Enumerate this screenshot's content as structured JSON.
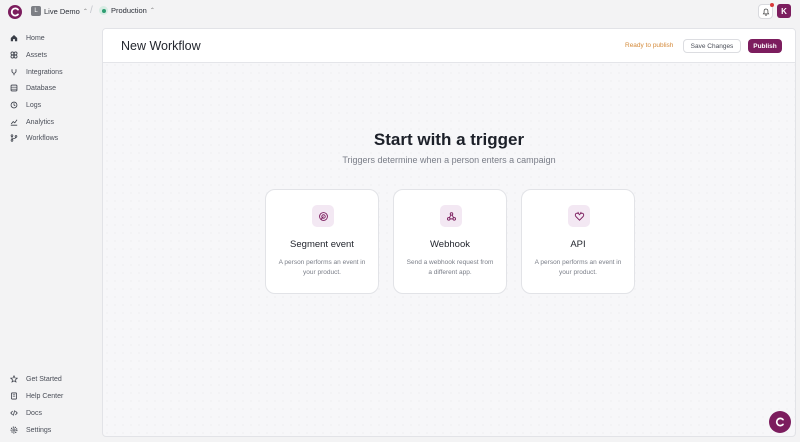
{
  "topbar": {
    "workspace_initial": "L",
    "workspace_name": "Live Demo",
    "separator": "/",
    "environment": "Production",
    "user_initial": "K"
  },
  "sidebar": {
    "primary": [
      {
        "label": "Home",
        "icon": "home-icon"
      },
      {
        "label": "Assets",
        "icon": "assets-icon"
      },
      {
        "label": "Integrations",
        "icon": "integrations-icon"
      },
      {
        "label": "Database",
        "icon": "database-icon"
      },
      {
        "label": "Logs",
        "icon": "logs-icon"
      },
      {
        "label": "Analytics",
        "icon": "analytics-icon"
      },
      {
        "label": "Workflows",
        "icon": "workflows-icon"
      }
    ],
    "secondary": [
      {
        "label": "Get Started",
        "icon": "star-icon"
      },
      {
        "label": "Help Center",
        "icon": "book-icon"
      },
      {
        "label": "Docs",
        "icon": "code-icon"
      },
      {
        "label": "Settings",
        "icon": "gear-icon"
      }
    ]
  },
  "header": {
    "title": "New Workflow",
    "status": "Ready to publish",
    "save_label": "Save Changes",
    "publish_label": "Publish"
  },
  "main": {
    "heading": "Start with a trigger",
    "subheading": "Triggers determine when a person enters a campaign",
    "cards": [
      {
        "title": "Segment event",
        "description": "A person performs an event in your product.",
        "icon": "segment-icon"
      },
      {
        "title": "Webhook",
        "description": "Send a webhook request from a different app.",
        "icon": "webhook-icon"
      },
      {
        "title": "API",
        "description": "A person performs an event in your product.",
        "icon": "api-icon"
      }
    ]
  },
  "colors": {
    "brand": "#7c1d5e",
    "status": "#d48a3a",
    "environment_dot": "#2e9e72"
  }
}
